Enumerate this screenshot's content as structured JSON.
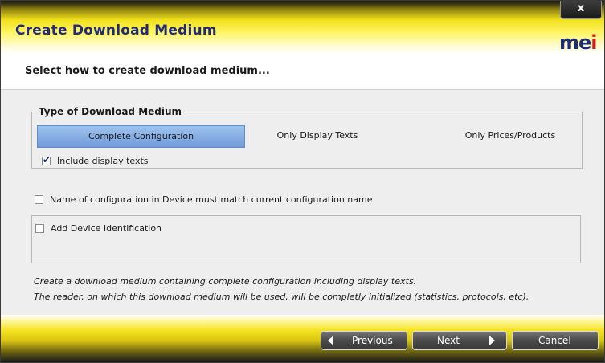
{
  "window": {
    "title": "Create Download Medium",
    "close_label": "x",
    "logo_text_a": "me",
    "logo_text_b": "i"
  },
  "subheader": "Select how to create download medium...",
  "medium_group": {
    "legend": "Type of Download Medium",
    "options": [
      {
        "label": "Complete Configuration",
        "selected": true
      },
      {
        "label": "Only Display Texts",
        "selected": false
      },
      {
        "label": "Only Prices/Products",
        "selected": false
      }
    ],
    "include_display_texts": {
      "label": "Include display texts",
      "checked": true
    }
  },
  "match_name": {
    "label": "Name of configuration in Device must match current configuration name",
    "checked": false
  },
  "add_device_id": {
    "label": "Add Device Identification",
    "checked": false
  },
  "description": {
    "line1": "Create a download medium containing complete configuration including display texts.",
    "line2": "The reader, on which this download medium will be used, will be completly initialized (statistics, protocols, etc)."
  },
  "footer": {
    "previous_label": "Previous",
    "next_label": "Next",
    "cancel_label": "Cancel"
  },
  "colors": {
    "title_text": "#1e2a7a",
    "accent_yellow": "#f2e11a",
    "selected_option": "#8fb6ea"
  }
}
